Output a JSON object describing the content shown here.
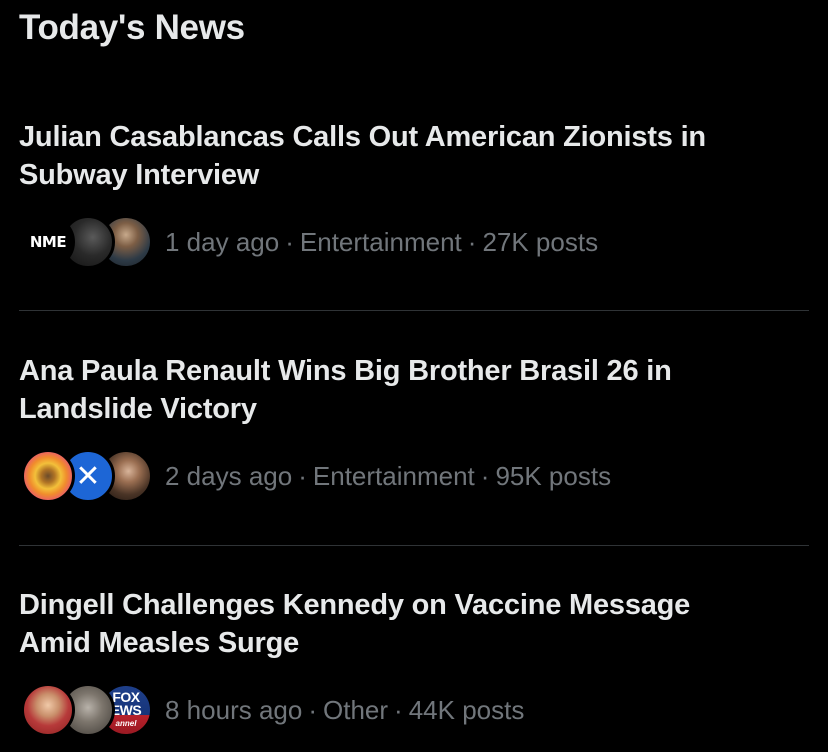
{
  "section": {
    "title": "Today's News"
  },
  "items": [
    {
      "headline": "Julian Casablancas Calls Out American Zionists in Subway Interview",
      "headline_line1": "Julian Casablancas Calls Out American Zionists in",
      "headline_line2": "Subway Interview",
      "time": "1 day ago",
      "category": "Entertainment",
      "posts": "27K posts",
      "avatars": [
        {
          "icon": "nme-logo-avatar",
          "label": "NME"
        },
        {
          "icon": "dark-portrait-avatar"
        },
        {
          "icon": "man-portrait-avatar"
        }
      ]
    },
    {
      "headline": "Ana Paula Renault Wins Big Brother Brasil 26 in Landslide Victory",
      "headline_line1": "Ana Paula Renault Wins Big Brother Brasil 26 in",
      "headline_line2": "Landslide Victory",
      "time": "2 days ago",
      "category": "Entertainment",
      "posts": "95K posts",
      "avatars": [
        {
          "icon": "eye-logo-avatar"
        },
        {
          "icon": "blue-logo-avatar",
          "label": "✕"
        },
        {
          "icon": "woman-portrait-avatar"
        }
      ]
    },
    {
      "headline": "Dingell Challenges Kennedy on Vaccine Message Amid Measles Surge",
      "headline_line1": "Dingell Challenges Kennedy on Vaccine Message",
      "headline_line2": "Amid Measles Surge",
      "time": "8 hours ago",
      "category": "Other",
      "posts": "44K posts",
      "avatars": [
        {
          "icon": "man-portrait-avatar"
        },
        {
          "icon": "gray-portrait-avatar"
        },
        {
          "icon": "fox-news-logo-avatar",
          "label_line1": "FOX",
          "label_line2": "EWS",
          "label_line3": "annel"
        }
      ]
    }
  ],
  "separator": "·",
  "colors": {
    "background": "#000000",
    "text_primary": "#e7e9ea",
    "text_secondary": "#71767b",
    "divider": "#2f3336"
  }
}
